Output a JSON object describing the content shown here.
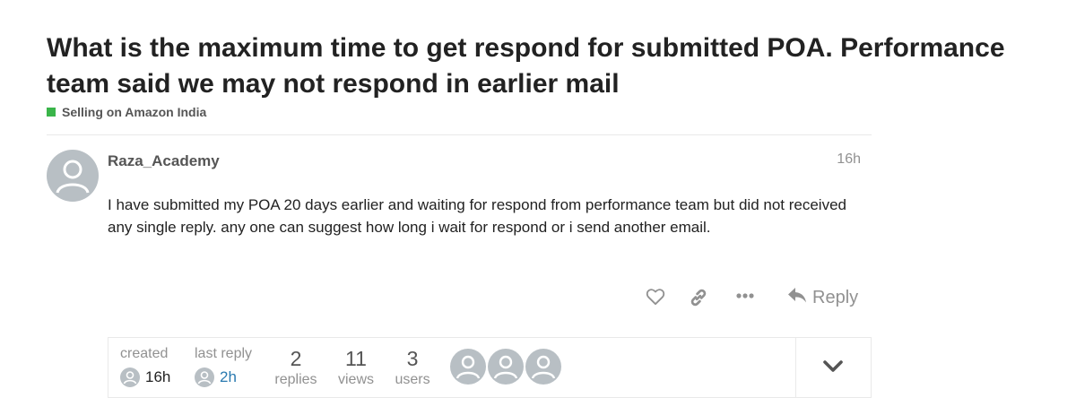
{
  "topic": {
    "title": "What is the maximum time to get respond for submitted POA. Performance team said we may not respond in earlier mail",
    "category": {
      "name": "Selling on Amazon India",
      "color": "#3ab54a"
    }
  },
  "post": {
    "avatar_icon": "user-avatar-icon",
    "username": "Raza_Academy",
    "time": "16h",
    "body": "I have submitted my POA 20 days earlier and waiting for respond from performance team but did not received any single reply. any one can suggest how long i wait for respond or i send another email.",
    "actions": {
      "like_icon": "heart-icon",
      "link_icon": "link-icon",
      "more_icon": "ellipsis-icon",
      "reply_icon": "reply-arrow-icon",
      "reply_label": "Reply"
    }
  },
  "topic_map": {
    "created": {
      "label": "created",
      "value": "16h"
    },
    "last_reply": {
      "label": "last reply",
      "value": "2h"
    },
    "replies": {
      "count": "2",
      "label": "replies"
    },
    "views": {
      "count": "11",
      "label": "views"
    },
    "users": {
      "count": "3",
      "label": "users"
    },
    "participants": [
      "user-avatar-icon",
      "user-avatar-icon",
      "user-avatar-icon"
    ],
    "expand_icon": "chevron-down-icon"
  },
  "colors": {
    "avatar_bg": "#b8bfc4",
    "link_blue": "#2a7ab0",
    "muted": "#919191"
  }
}
